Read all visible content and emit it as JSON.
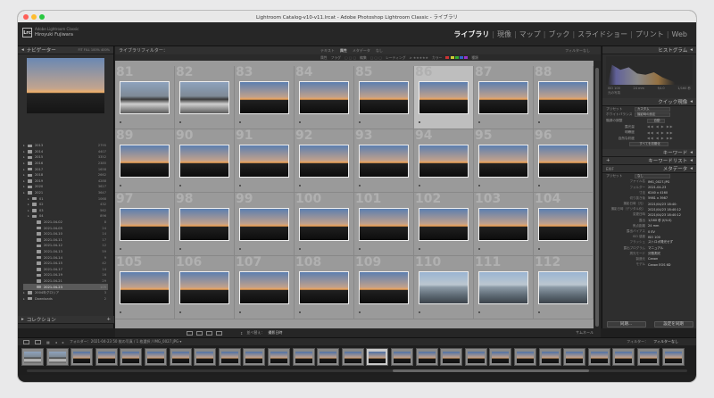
{
  "window": {
    "title": "Lightroom Catalog-v10-v11.lrcat - Adobe Photoshop Lightroom Classic - ライブラリ"
  },
  "identity": {
    "app": "Adobe Lightroom Classic",
    "user": "Hiroyuki Fujiwara",
    "logo": "Lrc"
  },
  "modules": [
    {
      "label": "ライブラリ",
      "active": true
    },
    {
      "label": "現像"
    },
    {
      "label": "マップ"
    },
    {
      "label": "ブック"
    },
    {
      "label": "スライドショー"
    },
    {
      "label": "プリント"
    },
    {
      "label": "Web"
    }
  ],
  "navigator": {
    "title": "ナビゲーター",
    "options": "FIT  FILL  100%  400%"
  },
  "folders": [
    {
      "name": "2013",
      "count": "2795",
      "indent": 0
    },
    {
      "name": "2014",
      "count": "4407",
      "indent": 0
    },
    {
      "name": "2015",
      "count": "3352",
      "indent": 0
    },
    {
      "name": "2016",
      "count": "2385",
      "indent": 0
    },
    {
      "name": "2017",
      "count": "1658",
      "indent": 0
    },
    {
      "name": "2018",
      "count": "2662",
      "indent": 0
    },
    {
      "name": "2019",
      "count": "4288",
      "indent": 0
    },
    {
      "name": "2020",
      "count": "3627",
      "indent": 0
    },
    {
      "name": "2021",
      "count": "3647",
      "indent": 0
    },
    {
      "name": "01",
      "count": "1068",
      "indent": 1
    },
    {
      "name": "02",
      "count": "432",
      "indent": 1
    },
    {
      "name": "03",
      "count": "562",
      "indent": 1
    },
    {
      "name": "04",
      "count": "896",
      "indent": 1
    },
    {
      "name": "2021-04-02",
      "count": "8",
      "indent": 2
    },
    {
      "name": "2021-04-05",
      "count": "24",
      "indent": 2
    },
    {
      "name": "2021-04-10",
      "count": "14",
      "indent": 2
    },
    {
      "name": "2021-04-11",
      "count": "17",
      "indent": 2
    },
    {
      "name": "2021-04-12",
      "count": "12",
      "indent": 2
    },
    {
      "name": "2021-04-13",
      "count": "59",
      "indent": 2
    },
    {
      "name": "2021-04-14",
      "count": "9",
      "indent": 2
    },
    {
      "name": "2021-04-15",
      "count": "42",
      "indent": 2
    },
    {
      "name": "2021-04-17",
      "count": "14",
      "indent": 2
    },
    {
      "name": "2021-04-19",
      "count": "16",
      "indent": 2
    },
    {
      "name": "2021-04-21",
      "count": "29",
      "indent": 2
    },
    {
      "name": "2021-04-23",
      "count": "105",
      "indent": 2,
      "selected": true
    },
    {
      "name": "2004年グロリア",
      "count": "3",
      "indent": 0
    },
    {
      "name": "Downloads",
      "count": "2",
      "indent": 0
    }
  ],
  "collection": {
    "title": "コレクション"
  },
  "left_buttons": {
    "import": "読み込み...",
    "export": "書き出し..."
  },
  "library_filter": {
    "title": "ライブラリフィルター：",
    "tabs": [
      "テキスト",
      "属性",
      "メタデータ",
      "なし"
    ],
    "active_tab": "属性",
    "right": "フィルターなし"
  },
  "attribute_bar": {
    "label": "属性",
    "flag": "フラグ",
    "edit": "編集",
    "rating": "レーティング",
    "color": "カラー",
    "kind": "種類"
  },
  "grid": {
    "cells": [
      {
        "num": "81",
        "kind": "crowd"
      },
      {
        "num": "82",
        "kind": "crowd"
      },
      {
        "num": "83",
        "kind": "dusk"
      },
      {
        "num": "84",
        "kind": "dusk"
      },
      {
        "num": "85",
        "kind": "dusk"
      },
      {
        "num": "86",
        "kind": "dusk",
        "selected": true
      },
      {
        "num": "87",
        "kind": "dusk"
      },
      {
        "num": "88",
        "kind": "dusk"
      },
      {
        "num": "89",
        "kind": "dusk"
      },
      {
        "num": "90",
        "kind": "dusk"
      },
      {
        "num": "91",
        "kind": "dusk"
      },
      {
        "num": "92",
        "kind": "dusk"
      },
      {
        "num": "93",
        "kind": "dusk"
      },
      {
        "num": "94",
        "kind": "dusk"
      },
      {
        "num": "95",
        "kind": "dusk"
      },
      {
        "num": "96",
        "kind": "dusk"
      },
      {
        "num": "97",
        "kind": "dusk"
      },
      {
        "num": "98",
        "kind": "dusk"
      },
      {
        "num": "99",
        "kind": "dusk"
      },
      {
        "num": "100",
        "kind": "dusk"
      },
      {
        "num": "101",
        "kind": "dusk"
      },
      {
        "num": "102",
        "kind": "dusk"
      },
      {
        "num": "103",
        "kind": "dusk"
      },
      {
        "num": "104",
        "kind": "dusk"
      },
      {
        "num": "105",
        "kind": "dusk"
      },
      {
        "num": "106",
        "kind": "dusk"
      },
      {
        "num": "107",
        "kind": "dusk"
      },
      {
        "num": "108",
        "kind": "dusk"
      },
      {
        "num": "109",
        "kind": "dusk"
      },
      {
        "num": "110",
        "kind": "city"
      },
      {
        "num": "111",
        "kind": "city"
      },
      {
        "num": "112",
        "kind": "city"
      }
    ]
  },
  "toolbar": {
    "sort_label": "並べ替え：",
    "sort_value": "撮影日時",
    "thumbs": "サムネール"
  },
  "histogram": {
    "title": "ヒストグラム",
    "iso": "ISO 100",
    "focal": "24 mm",
    "aperture": "f/4.0",
    "shutter": "1/160 秒",
    "tag": "元の写真"
  },
  "quick_develop": {
    "title": "クイック現像",
    "preset_label": "プリセット",
    "preset": "カスタム",
    "wb_label": "ホワイトバランス",
    "wb": "撮影時の設定",
    "tone_label": "階調の調整",
    "auto": "自動",
    "rows": [
      "露光量",
      "明瞭度",
      "自然な彩度"
    ],
    "reset": "すべてを初期化"
  },
  "keywords": {
    "title": "キーワード"
  },
  "keyword_list": {
    "title": "キーワードリスト"
  },
  "metadata": {
    "title": "メタデータ",
    "preset_label": "プリセット",
    "preset": "なし",
    "mode": "EXIF",
    "rows": [
      {
        "k": "ファイル名",
        "v": "IMG_0027.JPG"
      },
      {
        "k": "フォルダー",
        "v": "2021-04-23"
      },
      {
        "k": "寸法",
        "v": "6240 x 4160"
      },
      {
        "k": "切り抜き後",
        "v": "5981 x 3987"
      },
      {
        "k": "撮影日時（元）",
        "v": "2021/04/23 18:40:"
      },
      {
        "k": "撮影日時（デジタル化）",
        "v": "2021/04/23 18:40:12"
      },
      {
        "k": "変更日時",
        "v": "2021/04/23 18:40:12"
      },
      {
        "k": "露出",
        "v": "1/160 秒 (f/4.0)"
      },
      {
        "k": "焦点距離",
        "v": "24 mm"
      },
      {
        "k": "露出バイアス",
        "v": "0 EV"
      },
      {
        "k": "ISO 感度",
        "v": "ISO 100"
      },
      {
        "k": "フラッシュ",
        "v": "ストロボ発光せず"
      },
      {
        "k": "露出プログラム",
        "v": "マニュアル"
      },
      {
        "k": "測光モード",
        "v": "分割測光"
      },
      {
        "k": "製造元",
        "v": "Canon"
      },
      {
        "k": "モデル",
        "v": "Canon EOS 6D"
      }
    ]
  },
  "right_buttons": {
    "sync": "同期...",
    "sync_settings": "設定を同期"
  },
  "filmstrip": {
    "path": "フォルダー：2021-04-23  50 枚の写真 / 1 枚選択 / IMG_0027.JPG ▾",
    "filter": "フィルター：",
    "filter_value": "フィルターなし",
    "selected_index": 14
  }
}
